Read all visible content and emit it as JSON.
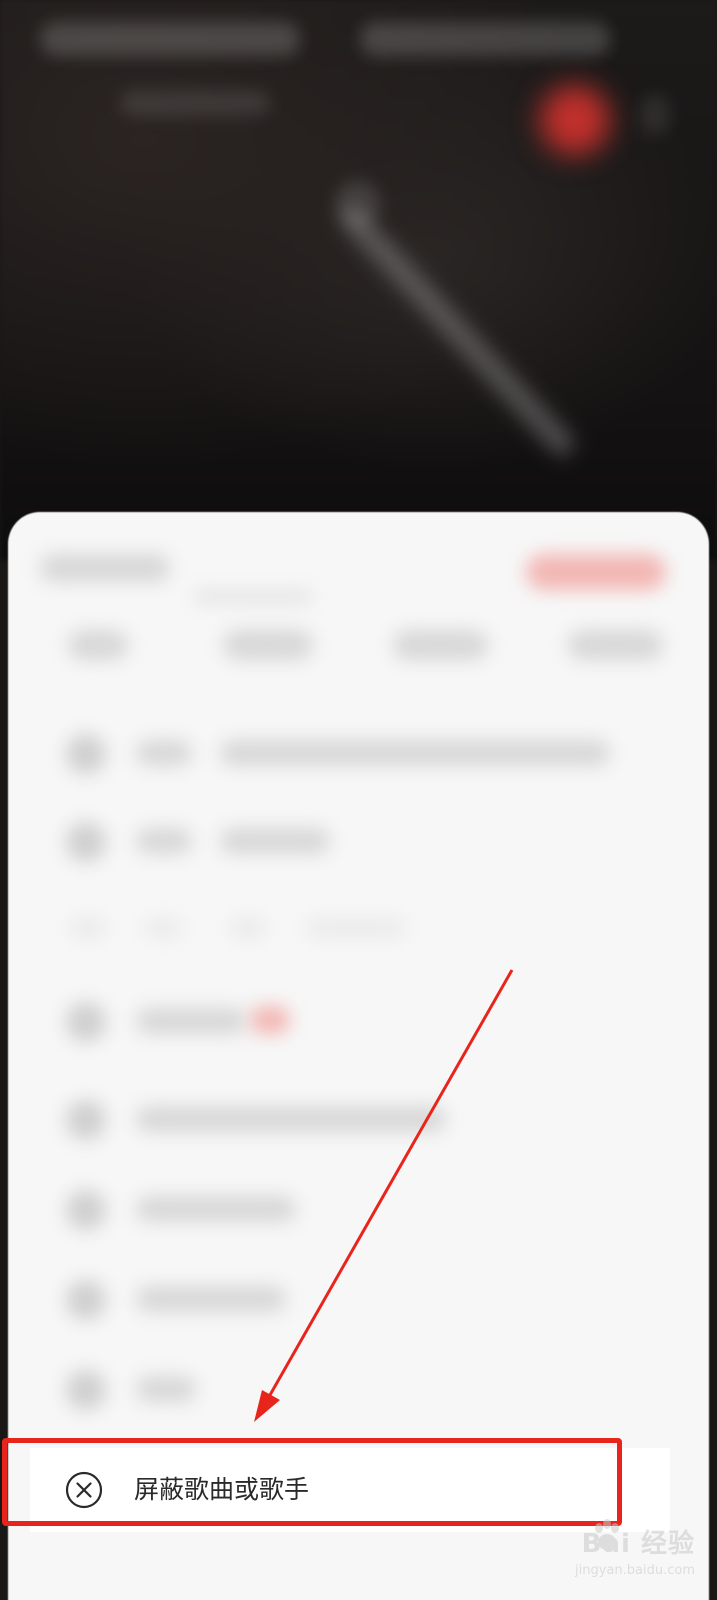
{
  "menu": {
    "block_label": "屏蔽歌曲或歌手",
    "block_icon": "close-circle-icon"
  },
  "annotation": {
    "arrow_color": "#e8251c",
    "highlight_color": "#e8251c"
  },
  "watermark": {
    "brand_text": "Bai 经验",
    "url_text": "jingyan.baidu.com"
  }
}
